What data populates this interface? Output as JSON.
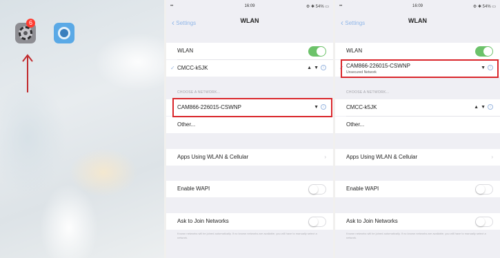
{
  "home": {
    "settings_badge": "6",
    "annotation_color": "#c0282b"
  },
  "screen2": {
    "status_time": "16:09",
    "status_right": "⚙ ✱ 54% ▭",
    "back_label": "Settings",
    "title": "WLAN",
    "wlan_label": "WLAN",
    "wlan_on": true,
    "connected_network": "CMCC-k5JK",
    "section_header": "CHOOSE A NETWORK...",
    "network_1": "CAM866-226015-CSWNP",
    "other_label": "Other...",
    "apps_label": "Apps Using WLAN & Cellular",
    "wapi_label": "Enable WAPI",
    "ask_label": "Ask to Join Networks",
    "ask_footnote": "Known networks will be joined automatically. If no known networks are available, you will have to manually select a network."
  },
  "screen3": {
    "status_time": "16:09",
    "status_right": "⚙ ✱ 54% ▭",
    "back_label": "Settings",
    "title": "WLAN",
    "wlan_label": "WLAN",
    "wlan_on": true,
    "connected_network": "CAM866-226015-CSWNP",
    "connected_sub": "Unsecured Network",
    "section_header": "CHOOSE A NETWORK...",
    "network_1": "CMCC-k5JK",
    "other_label": "Other...",
    "apps_label": "Apps Using WLAN & Cellular",
    "wapi_label": "Enable WAPI",
    "ask_label": "Ask to Join Networks",
    "ask_footnote": "Known networks will be joined automatically. If no known networks are available, you will have to manually select a network."
  },
  "icons": {
    "lock": "🔒",
    "wifi": "wifi-icon",
    "info": "i",
    "check": "✓",
    "chevron_left": "‹"
  },
  "colors": {
    "accent": "#8fb6e8",
    "toggle_on": "#6cc26a",
    "highlight": "#d9252a"
  }
}
